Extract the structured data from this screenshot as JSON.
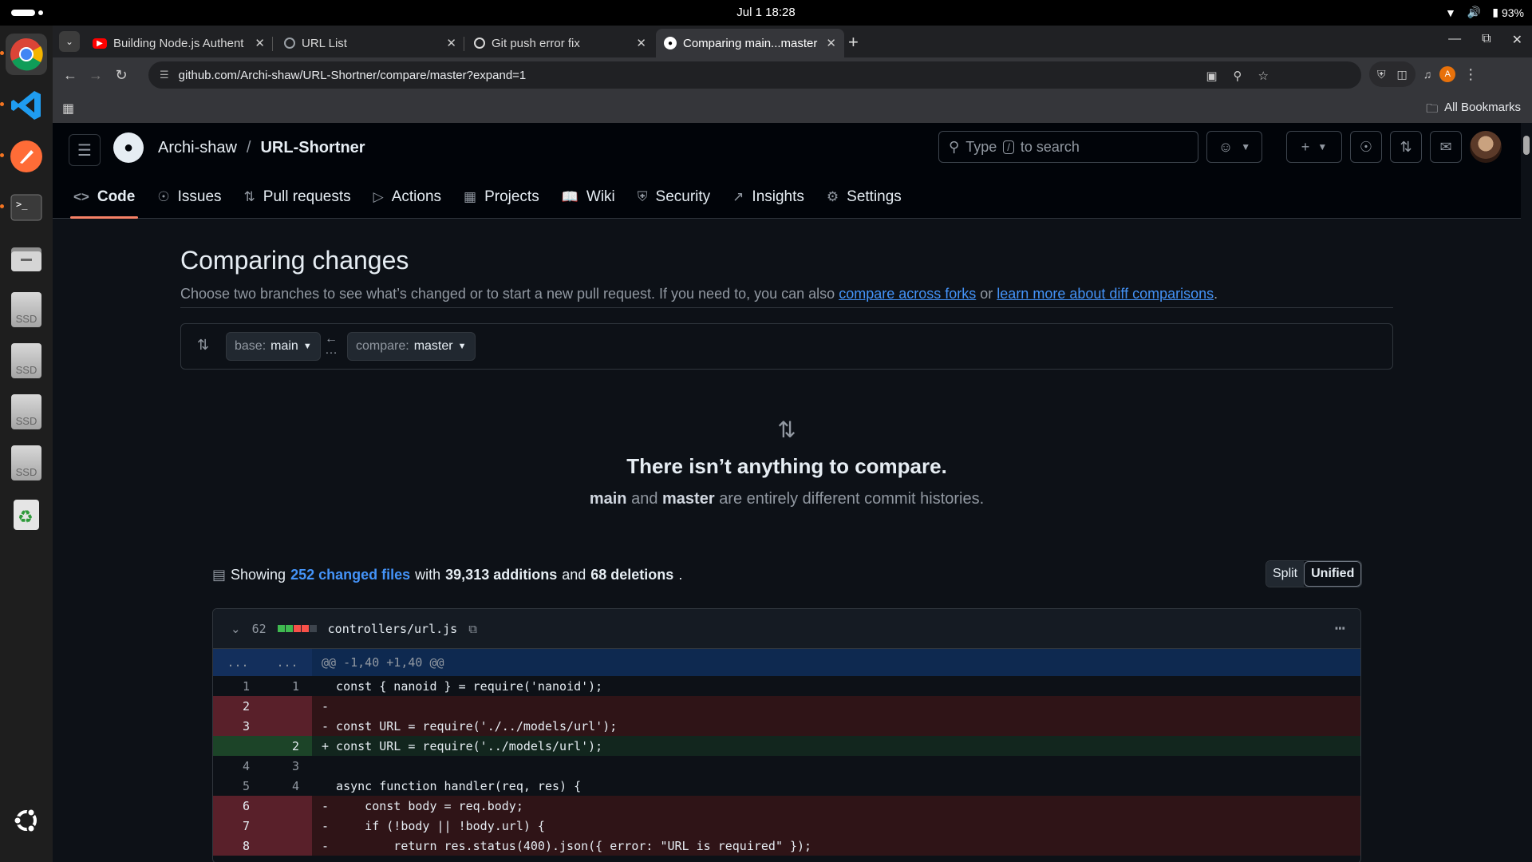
{
  "system": {
    "clock": "Jul 1  18:28",
    "battery": "93%"
  },
  "browser": {
    "tabs": [
      {
        "title": "Building Node.js Authent",
        "fav_color": "#ff0000"
      },
      {
        "title": "URL List",
        "fav_color": "#9aa0a6"
      },
      {
        "title": "Git push error fix",
        "fav_color": "#9aa0a6"
      },
      {
        "title": "Comparing main...master",
        "fav_color": "#ffffff"
      }
    ],
    "url": "github.com/Archi-shaw/URL-Shortner/compare/master?expand=1",
    "profile_initial": "A",
    "all_bookmarks": "All Bookmarks"
  },
  "github": {
    "owner": "Archi-shaw",
    "repo": "URL-Shortner",
    "search_prefix": "Type",
    "search_key": "/",
    "search_suffix": "to search",
    "nav": [
      "Code",
      "Issues",
      "Pull requests",
      "Actions",
      "Projects",
      "Wiki",
      "Security",
      "Insights",
      "Settings"
    ]
  },
  "compare": {
    "title": "Comparing changes",
    "subtitle_text": "Choose two branches to see what’s changed or to start a new pull request. If you need to, you can also",
    "link_forks": "compare across forks",
    "or_text": "or",
    "link_learn": "learn more about diff comparisons",
    "base_prefix": "base:",
    "base_branch": "main",
    "compare_prefix": "compare:",
    "compare_branch": "master",
    "blank_title": "There isn’t anything to compare.",
    "blank_main": "main",
    "blank_and": "and",
    "blank_master": "master",
    "blank_rest": "are entirely different commit histories."
  },
  "summary": {
    "showing": "Showing",
    "changed_files": "252 changed files",
    "with": "with",
    "additions": "39,313 additions",
    "and": "and",
    "deletions": "68 deletions",
    "split": "Split",
    "unified": "Unified"
  },
  "file": {
    "changes": "62",
    "path": "controllers/url.js",
    "hunk_left": "...",
    "hunk_right": "...",
    "hunk": "@@ -1,40 +1,40 @@",
    "lines": [
      {
        "type": "ctx",
        "old": "1",
        "new": "1",
        "text": "  const { nanoid } = require('nanoid');"
      },
      {
        "type": "del",
        "old": "2",
        "new": "",
        "text": "- "
      },
      {
        "type": "del",
        "old": "3",
        "new": "",
        "text": "- const URL = require('./../models/url');"
      },
      {
        "type": "add",
        "old": "",
        "new": "2",
        "text": "+ const URL = require('../models/url');"
      },
      {
        "type": "ctx",
        "old": "4",
        "new": "3",
        "text": "  "
      },
      {
        "type": "ctx",
        "old": "5",
        "new": "4",
        "text": "  async function handler(req, res) {"
      },
      {
        "type": "del",
        "old": "6",
        "new": "",
        "text": "-     const body = req.body;"
      },
      {
        "type": "del",
        "old": "7",
        "new": "",
        "text": "-     if (!body || !body.url) {"
      },
      {
        "type": "del",
        "old": "8",
        "new": "",
        "text": "-         return res.status(400).json({ error: \"URL is required\" });"
      }
    ]
  }
}
